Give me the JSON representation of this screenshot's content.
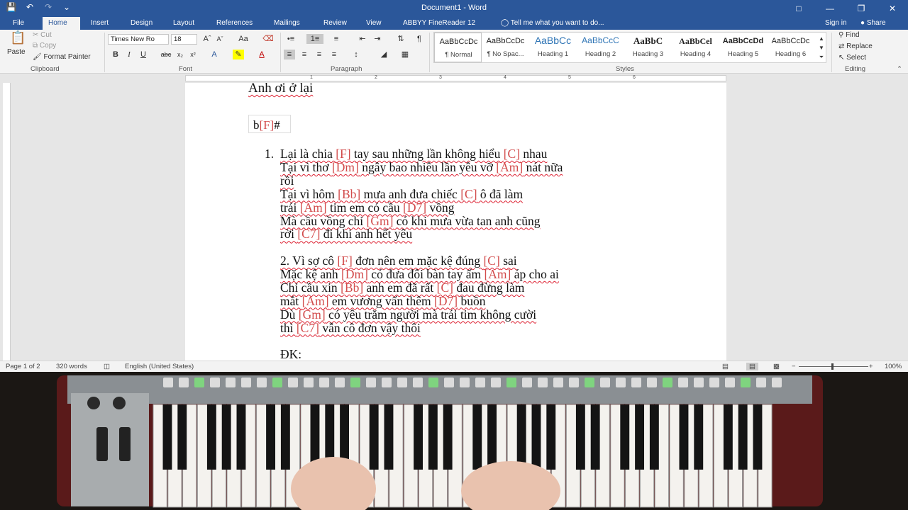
{
  "window": {
    "title": "Document1 - Word"
  },
  "titlebar_icons": [
    "save-icon",
    "undo-icon",
    "redo-icon",
    "customize-qat-icon"
  ],
  "tabs": [
    {
      "label": "File"
    },
    {
      "label": "Home"
    },
    {
      "label": "Insert"
    },
    {
      "label": "Design"
    },
    {
      "label": "Layout"
    },
    {
      "label": "References"
    },
    {
      "label": "Mailings"
    },
    {
      "label": "Review"
    },
    {
      "label": "View"
    },
    {
      "label": "ABBYY FineReader 12"
    },
    {
      "label": "Tell me what you want to do..."
    }
  ],
  "account": {
    "sign_in": "Sign in",
    "share": "Share"
  },
  "clipboard": {
    "paste": "Paste",
    "cut": "Cut",
    "copy": "Copy",
    "format_painter": "Format Painter",
    "label": "Clipboard"
  },
  "font": {
    "name": "Times New Ro",
    "size": "18",
    "label": "Font"
  },
  "paragraph": {
    "label": "Paragraph"
  },
  "styles": {
    "label": "Styles",
    "items": [
      {
        "preview": "AaBbCcDc",
        "name": "¶ Normal"
      },
      {
        "preview": "AaBbCcDc",
        "name": "¶ No Spac..."
      },
      {
        "preview": "AaBbCc",
        "name": "Heading 1"
      },
      {
        "preview": "AaBbCcC",
        "name": "Heading 2"
      },
      {
        "preview": "AaBbC",
        "name": "Heading 3"
      },
      {
        "preview": "AaBbCel",
        "name": "Heading 4"
      },
      {
        "preview": "AaBbCcDd",
        "name": "Heading 5"
      },
      {
        "preview": "AaBbCcDc",
        "name": "Heading 6"
      }
    ]
  },
  "editing": {
    "find": "Find",
    "replace": "Replace",
    "select": "Select",
    "label": "Editing"
  },
  "ruler": {
    "numbers": [
      "1",
      "2",
      "3",
      "4",
      "5",
      "6"
    ]
  },
  "document": {
    "heading": "Anh ơi ở lại",
    "box": {
      "b": "b",
      "chord": "[F]",
      "sharp": "#"
    },
    "verse1": {
      "number": "1.",
      "lines": [
        [
          "Lại là chia ",
          "[F]",
          " tay sau những lần không hiểu ",
          "[C]",
          " nhau"
        ],
        [
          "Tại vì thơ ",
          "[Dm]",
          " ngây bao nhiêu lần yêu vỡ ",
          "[Am]",
          " nát nữa"
        ],
        [
          "rồi"
        ],
        [
          "Tại vì hôm ",
          "[Bb]",
          " mưa anh đưa chiếc ",
          "[C]",
          " ô đã làm"
        ],
        [
          "trái ",
          "[Am]",
          " tim em có cầu ",
          "[D7]",
          " vồng"
        ],
        [
          "Mà cầu vồng chỉ ",
          "[Gm]",
          " có khi mưa vừa tan anh cũng"
        ],
        [
          "rời ",
          "[C7]",
          " đi khi anh hết yêu"
        ]
      ]
    },
    "verse2": {
      "lines": [
        [
          "2. Vì sợ cô ",
          "[F]",
          " đơn nên em mặc kệ đúng ",
          "[C]",
          " sai"
        ],
        [
          "Mặc kệ anh ",
          "[Dm]",
          " có đưa đôi bàn tay ấm ",
          "[Am]",
          " áp cho ai"
        ],
        [
          "Chỉ cầu xin ",
          "[Bb]",
          " anh em đã rất ",
          "[C]",
          " đau đừng làm"
        ],
        [
          "mắt ",
          "[Am]",
          " em vương vấn thêm ",
          "[D7]",
          " buồn"
        ],
        [
          "Dù ",
          "[Gm]",
          " có yêu trăm người mà trái tim không cười"
        ],
        [
          "thì ",
          "[C7]",
          " vẫn cô đơn vậy thôi"
        ]
      ]
    },
    "chorus_label": "ĐK:"
  },
  "statusbar": {
    "page": "Page 1 of 2",
    "words": "320 words",
    "language": "English (United States)",
    "zoom": "100%"
  }
}
